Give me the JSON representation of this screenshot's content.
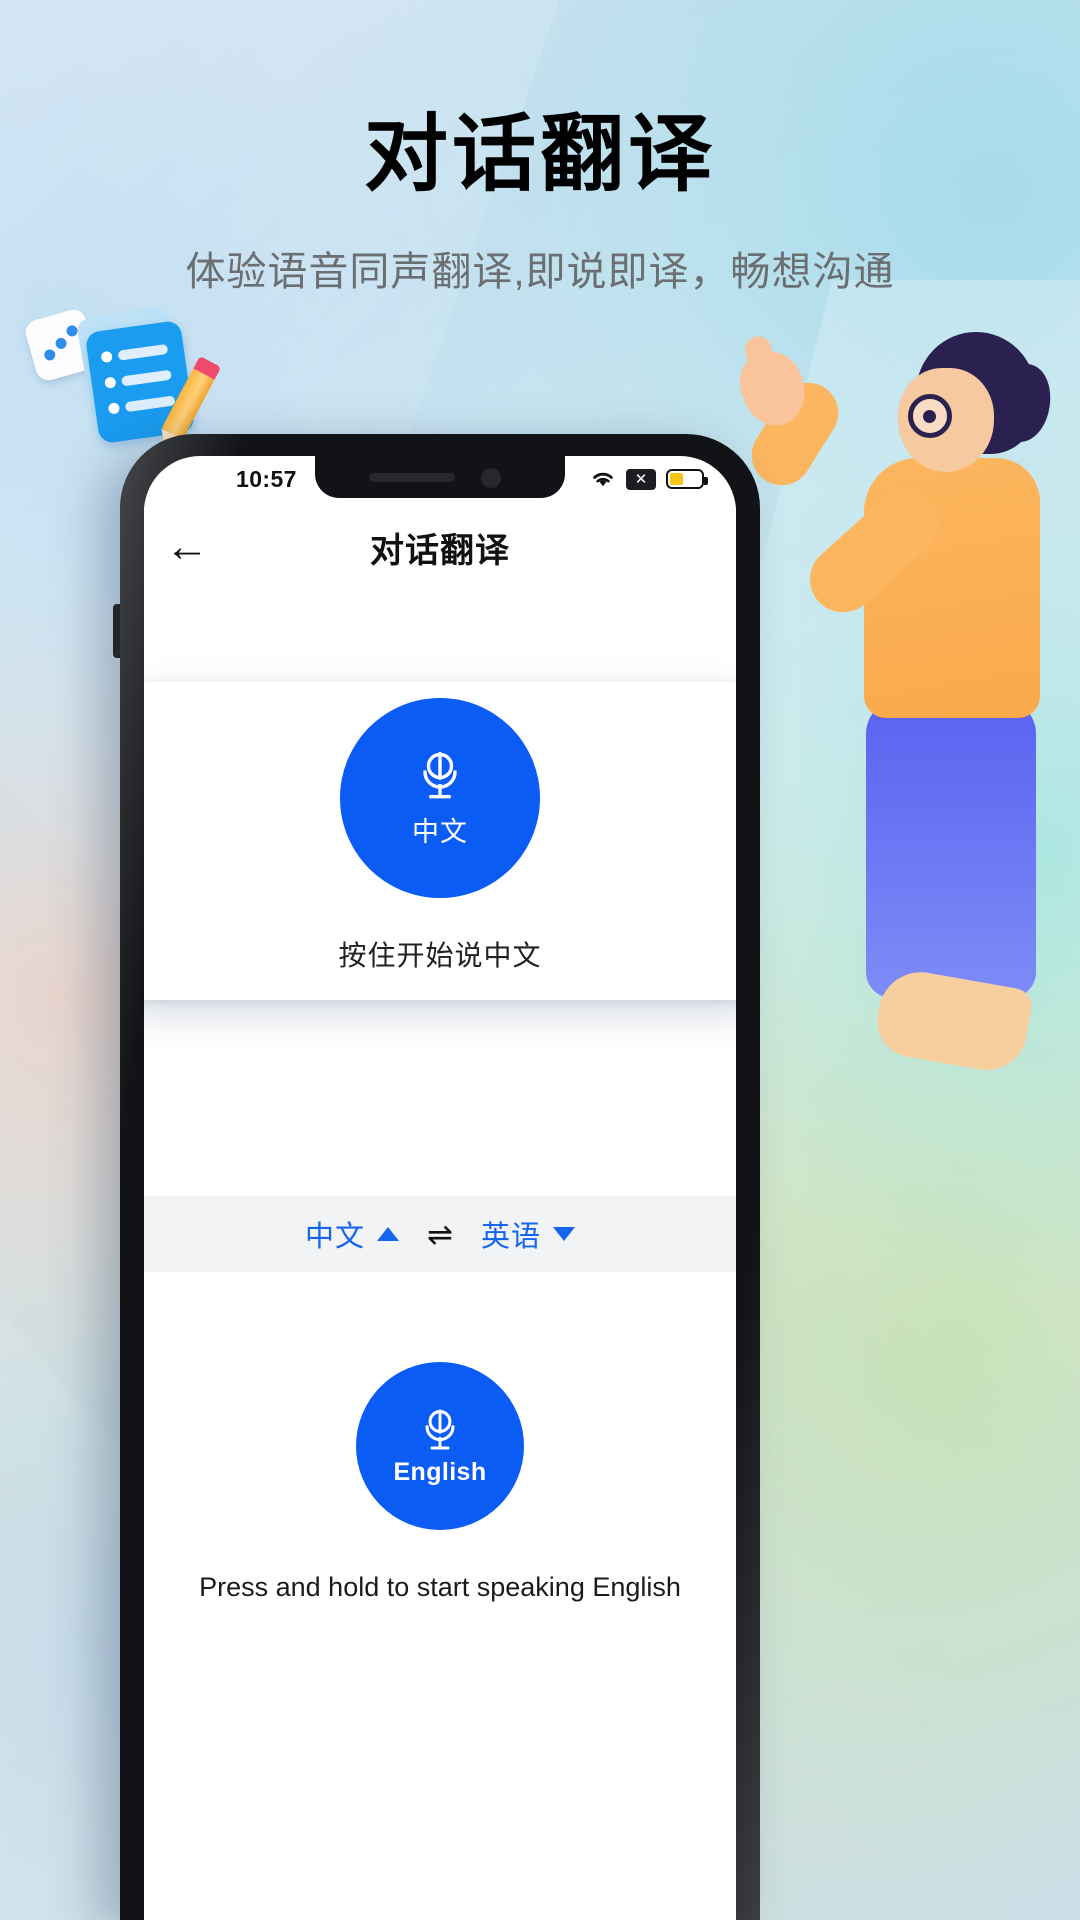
{
  "promo": {
    "title": "对话翻译",
    "subtitle": "体验语音同声翻译,即说即译，畅想沟通"
  },
  "colors": {
    "accent_blue": "#0b5cf5",
    "link_blue": "#1565f0",
    "battery_yellow": "#f5c518",
    "strip_gray": "#f2f3f5"
  },
  "phone": {
    "status_bar": {
      "time": "10:57",
      "wifi_icon": "wifi-icon",
      "sim_icon": "no-sim-icon",
      "sim_glyph": "✕",
      "battery_icon": "battery-icon",
      "battery_level": "42%"
    },
    "nav": {
      "back_icon": "back-arrow-icon",
      "back_glyph": "←",
      "title": "对话翻译"
    },
    "popup_card": {
      "mic_icon": "microphone-icon",
      "mic_button_label": "中文",
      "hint": "按住开始说中文"
    },
    "language_bar": {
      "source_language": "中文",
      "source_caret_icon": "caret-up-icon",
      "swap_icon": "swap-arrows-icon",
      "swap_glyph": "⇌",
      "target_language": "英语",
      "target_caret_icon": "caret-down-icon"
    },
    "bottom": {
      "mic_icon": "microphone-icon",
      "mic_button_label": "English",
      "hint": "Press and hold to start speaking English"
    }
  }
}
